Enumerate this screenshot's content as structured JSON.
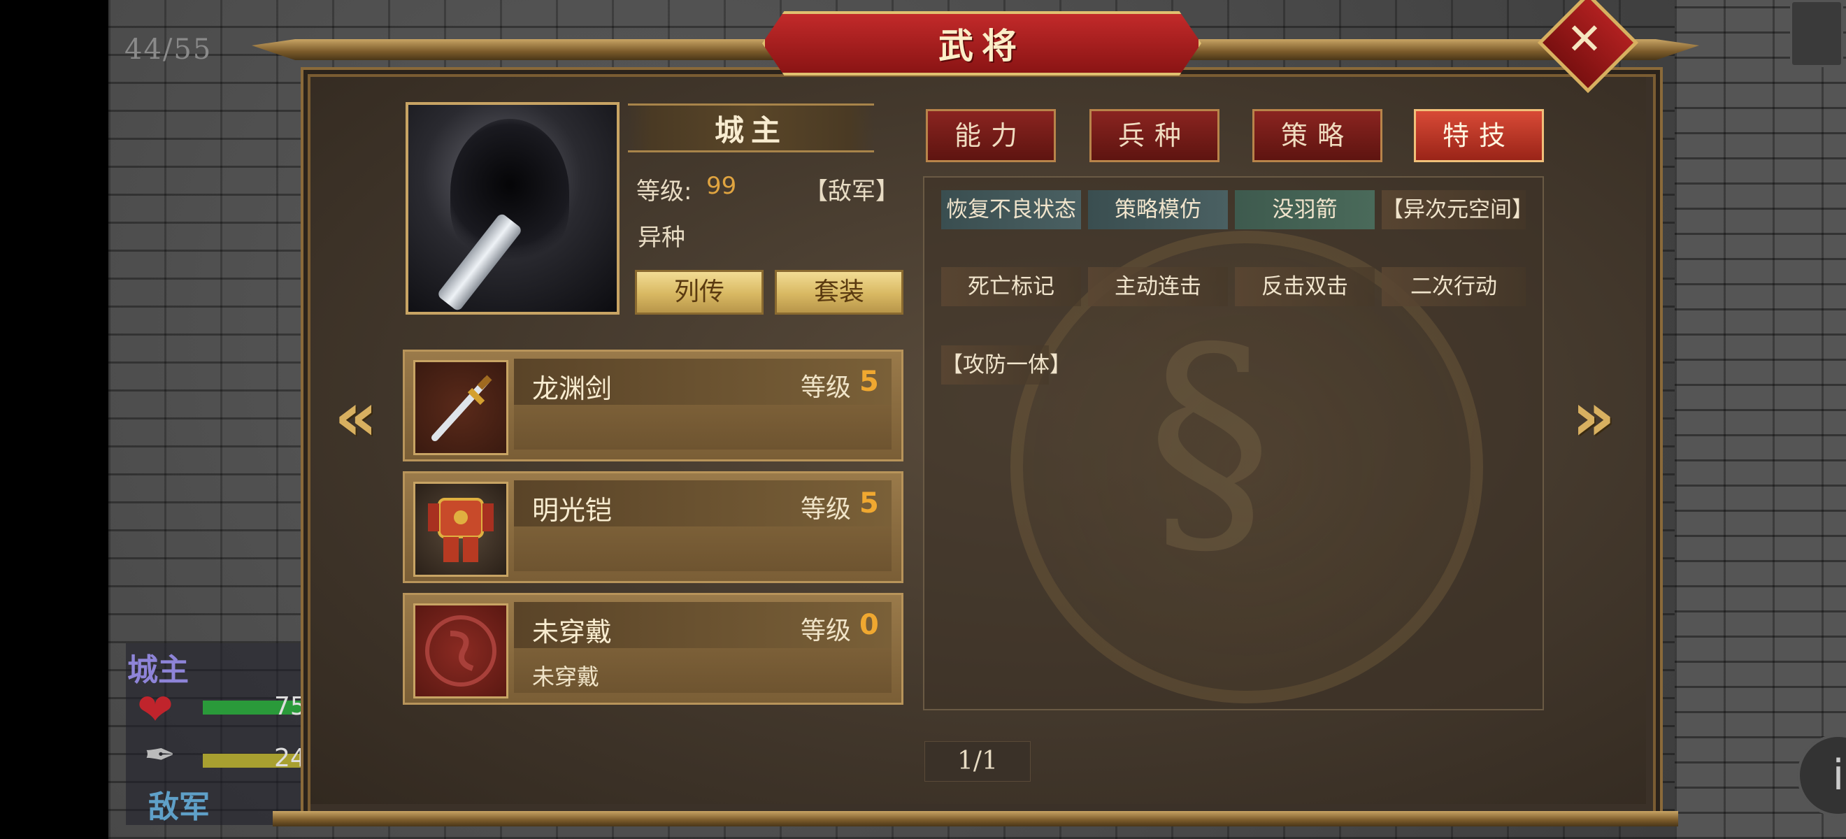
{
  "hud": {
    "turn_counter": "44/55",
    "unit_name": "城主",
    "unit_faction": "敌军",
    "hp_partial": "75",
    "mp_partial": "24"
  },
  "panel": {
    "title": "武将",
    "close_icon": "close-icon"
  },
  "general": {
    "name": "城主",
    "level_label": "等级:",
    "level_value": "99",
    "faction": "【敌军】",
    "race": "异种",
    "bio_button": "列传",
    "set_button": "套装"
  },
  "equipment": [
    {
      "name": "龙渊剑",
      "level_label": "等级",
      "level": "5",
      "desc": "",
      "icon": "sword-icon"
    },
    {
      "name": "明光铠",
      "level_label": "等级",
      "level": "5",
      "desc": "",
      "icon": "armor-icon"
    },
    {
      "name": "未穿戴",
      "level_label": "等级",
      "level": "0",
      "desc": "未穿戴",
      "icon": "empty-slot-icon"
    }
  ],
  "tabs": [
    {
      "label": "能力",
      "active": false
    },
    {
      "label": "兵种",
      "active": false
    },
    {
      "label": "策略",
      "active": false
    },
    {
      "label": "特技",
      "active": true
    }
  ],
  "skills": [
    "恢复不良状态",
    "策略模仿",
    "没羽箭",
    "【异次元空间】",
    "死亡标记",
    "主动连击",
    "反击双击",
    "二次行动",
    "【攻防一体】"
  ],
  "pagination": "1/1",
  "colors": {
    "accent_gold": "#d8b060",
    "tab_red": "#8a2420",
    "tab_active": "#d84a36",
    "level_orange": "#f0a830"
  }
}
